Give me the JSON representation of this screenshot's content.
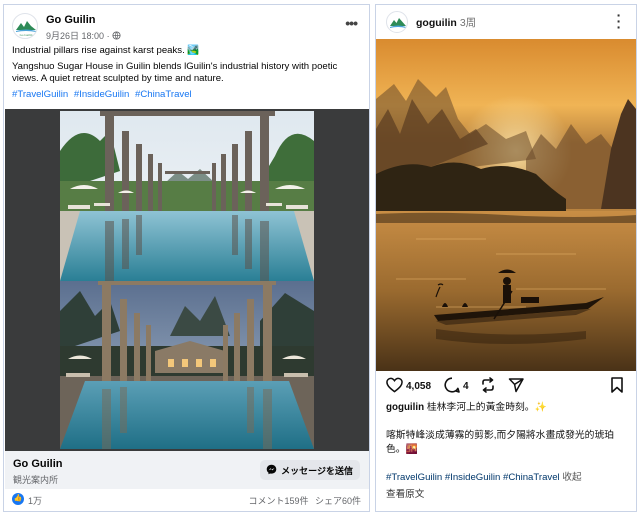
{
  "facebook": {
    "page_name": "Go Guilin",
    "post_date": "9月26日 18:00",
    "post_date_suffix": "·",
    "text_line1": "Industrial pillars rise against karst peaks. 🏞️",
    "text_line2": "Yangshuo Sugar House in Guilin blends lGuilin's industrial history with poetic views. A quiet retreat sculpted by time and nature.",
    "hashtags": [
      "#TravelGuilin",
      "#InsideGuilin",
      "#ChinaTravel"
    ],
    "footer_page_name": "Go Guilin",
    "footer_category": "観光案内所",
    "message_button": "メッセージを送信",
    "like_count": "1万",
    "comments": "コメント159件",
    "shares": "シェア60件",
    "icons": {
      "more": "more-icon",
      "like": "thumbs-up-icon",
      "messenger": "messenger-icon",
      "globe": "globe-icon"
    },
    "colors": {
      "link": "#1877f2",
      "button_bg": "#e4e6eb",
      "footer_bg": "#f0f2f5"
    }
  },
  "instagram": {
    "username": "goguilin",
    "time_ago": "3周",
    "likes": "4,058",
    "comments": "4",
    "caption_user": "goguilin",
    "caption_text": "桂林李河上的黃金時刻。✨",
    "description": "喀斯特峰淡成薄霧的剪影,而夕陽將水畫成發光的琥珀色。🌇",
    "hashtags": [
      "#TravelGuilin",
      "#InsideGuilin",
      "#ChinaTravel"
    ],
    "collapse_label": "收起",
    "see_original": "查看原文",
    "icons": {
      "more": "more-vertical-icon",
      "heart": "heart-icon",
      "comment": "comment-icon",
      "repost": "repost-icon",
      "share": "send-icon",
      "save": "bookmark-icon"
    },
    "colors": {
      "hashtag": "#00376b",
      "sunset": "#e69a3a"
    }
  }
}
